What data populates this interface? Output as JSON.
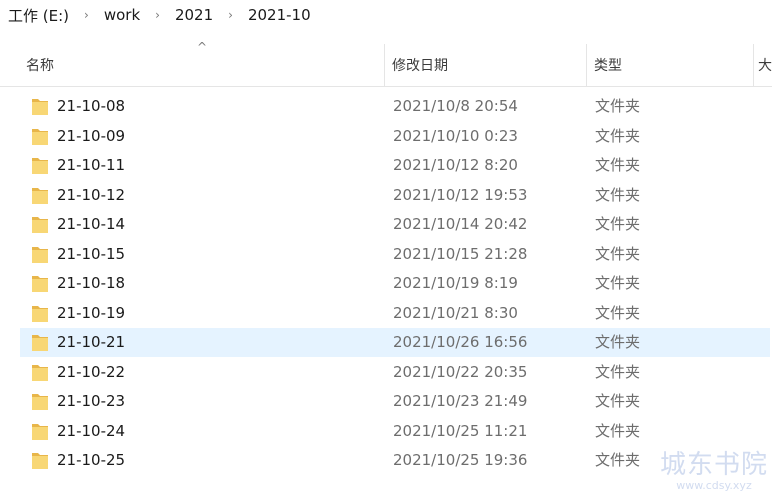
{
  "breadcrumb": {
    "items": [
      "工作 (E:)",
      "work",
      "2021",
      "2021-10"
    ],
    "separator": "›"
  },
  "columns": {
    "name": "名称",
    "date": "修改日期",
    "type": "类型",
    "extra": "大"
  },
  "sort_indicator": "^",
  "rows": [
    {
      "name": "21-10-08",
      "date": "2021/10/8 20:54",
      "type": "文件夹"
    },
    {
      "name": "21-10-09",
      "date": "2021/10/10 0:23",
      "type": "文件夹"
    },
    {
      "name": "21-10-11",
      "date": "2021/10/12 8:20",
      "type": "文件夹"
    },
    {
      "name": "21-10-12",
      "date": "2021/10/12 19:53",
      "type": "文件夹"
    },
    {
      "name": "21-10-14",
      "date": "2021/10/14 20:42",
      "type": "文件夹"
    },
    {
      "name": "21-10-15",
      "date": "2021/10/15 21:28",
      "type": "文件夹"
    },
    {
      "name": "21-10-18",
      "date": "2021/10/19 8:19",
      "type": "文件夹"
    },
    {
      "name": "21-10-19",
      "date": "2021/10/21 8:30",
      "type": "文件夹"
    },
    {
      "name": "21-10-21",
      "date": "2021/10/26 16:56",
      "type": "文件夹",
      "selected": true
    },
    {
      "name": "21-10-22",
      "date": "2021/10/22 20:35",
      "type": "文件夹"
    },
    {
      "name": "21-10-23",
      "date": "2021/10/23 21:49",
      "type": "文件夹"
    },
    {
      "name": "21-10-24",
      "date": "2021/10/25 11:21",
      "type": "文件夹"
    },
    {
      "name": "21-10-25",
      "date": "2021/10/25 19:36",
      "type": "文件夹"
    }
  ],
  "watermark": {
    "title": "城东书院",
    "url": "www.cdsy.xyz"
  },
  "colors": {
    "selected_row": "#e5f3ff",
    "folder_body": "#f8d775",
    "folder_tab": "#e8b64a"
  },
  "icons": {
    "folder": "folder-icon",
    "separator": "chevron-right-icon",
    "sort": "sort-up-icon"
  }
}
